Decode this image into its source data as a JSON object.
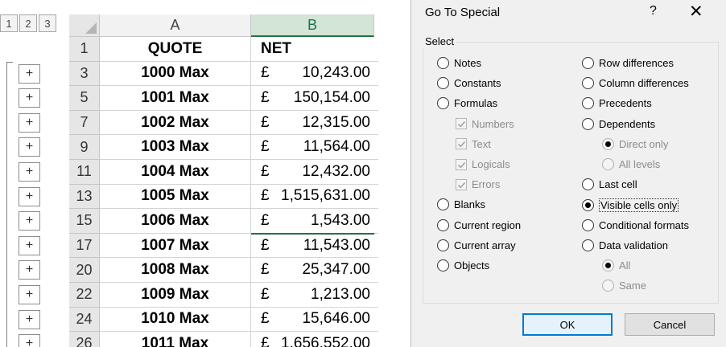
{
  "sheet": {
    "outline_levels": [
      "1",
      "2",
      "3"
    ],
    "columns": [
      {
        "label": "A",
        "selected": false
      },
      {
        "label": "B",
        "selected": true
      }
    ],
    "header_row": {
      "row": "1",
      "quote": "QUOTE",
      "net": "NET"
    },
    "rows": [
      {
        "row": "3",
        "quote": "1000 Max",
        "currency": "£",
        "amount": "10,243.00"
      },
      {
        "row": "5",
        "quote": "1001 Max",
        "currency": "£",
        "amount": "150,154.00"
      },
      {
        "row": "7",
        "quote": "1002 Max",
        "currency": "£",
        "amount": "12,315.00"
      },
      {
        "row": "9",
        "quote": "1003 Max",
        "currency": "£",
        "amount": "11,564.00"
      },
      {
        "row": "11",
        "quote": "1004 Max",
        "currency": "£",
        "amount": "12,432.00"
      },
      {
        "row": "13",
        "quote": "1005 Max",
        "currency": "£",
        "amount": "1,515,631.00"
      },
      {
        "row": "15",
        "quote": "1006 Max",
        "currency": "£",
        "amount": "1,543.00"
      },
      {
        "row": "17",
        "quote": "1007 Max",
        "currency": "£",
        "amount": "11,543.00"
      },
      {
        "row": "20",
        "quote": "1008 Max",
        "currency": "£",
        "amount": "25,347.00"
      },
      {
        "row": "22",
        "quote": "1009 Max",
        "currency": "£",
        "amount": "1,213.00"
      },
      {
        "row": "24",
        "quote": "1010 Max",
        "currency": "£",
        "amount": "15,646.00"
      },
      {
        "row": "26",
        "quote": "1011 Max",
        "currency": "£",
        "amount": "1,656,552.00"
      }
    ],
    "plus_label": "+",
    "accent_color": "#217346"
  },
  "dialog": {
    "title": "Go To Special",
    "help_label": "?",
    "close_label": "✕",
    "group_label": "Select",
    "left_options": [
      {
        "key": "notes",
        "label": "Notes",
        "type": "radio",
        "checked": false,
        "disabled": false
      },
      {
        "key": "constants",
        "label": "Constants",
        "type": "radio",
        "checked": false,
        "disabled": false
      },
      {
        "key": "formulas",
        "label": "Formulas",
        "type": "radio",
        "checked": false,
        "disabled": false
      },
      {
        "key": "numbers",
        "label": "Numbers",
        "type": "checkbox",
        "checked": true,
        "disabled": true
      },
      {
        "key": "text",
        "label": "Text",
        "type": "checkbox",
        "checked": true,
        "disabled": true
      },
      {
        "key": "logicals",
        "label": "Logicals",
        "type": "checkbox",
        "checked": true,
        "disabled": true
      },
      {
        "key": "errors",
        "label": "Errors",
        "type": "checkbox",
        "checked": true,
        "disabled": true
      },
      {
        "key": "blanks",
        "label": "Blanks",
        "type": "radio",
        "checked": false,
        "disabled": false
      },
      {
        "key": "current-region",
        "label": "Current region",
        "type": "radio",
        "checked": false,
        "disabled": false
      },
      {
        "key": "current-array",
        "label": "Current array",
        "type": "radio",
        "checked": false,
        "disabled": false
      },
      {
        "key": "objects",
        "label": "Objects",
        "type": "radio",
        "checked": false,
        "disabled": false
      }
    ],
    "right_options": [
      {
        "key": "row-differences",
        "label": "Row differences",
        "type": "radio",
        "checked": false,
        "disabled": false
      },
      {
        "key": "column-differences",
        "label": "Column differences",
        "type": "radio",
        "checked": false,
        "disabled": false
      },
      {
        "key": "precedents",
        "label": "Precedents",
        "type": "radio",
        "checked": false,
        "disabled": false
      },
      {
        "key": "dependents",
        "label": "Dependents",
        "type": "radio",
        "checked": false,
        "disabled": false
      },
      {
        "key": "direct-only",
        "label": "Direct only",
        "type": "radio",
        "checked": true,
        "disabled": true
      },
      {
        "key": "all-levels",
        "label": "All levels",
        "type": "radio",
        "checked": false,
        "disabled": true
      },
      {
        "key": "last-cell",
        "label": "Last cell",
        "type": "radio",
        "checked": false,
        "disabled": false
      },
      {
        "key": "visible-cells-only",
        "label": "Visible cells only",
        "type": "radio",
        "checked": true,
        "disabled": false,
        "focused": true
      },
      {
        "key": "conditional-formats",
        "label": "Conditional formats",
        "type": "radio",
        "checked": false,
        "disabled": false
      },
      {
        "key": "data-validation",
        "label": "Data validation",
        "type": "radio",
        "checked": false,
        "disabled": false
      },
      {
        "key": "all",
        "label": "All",
        "type": "radio",
        "checked": true,
        "disabled": true
      },
      {
        "key": "same",
        "label": "Same",
        "type": "radio",
        "checked": false,
        "disabled": true
      }
    ],
    "ok_label": "OK",
    "cancel_label": "Cancel",
    "focus_color": "#0078d7"
  }
}
